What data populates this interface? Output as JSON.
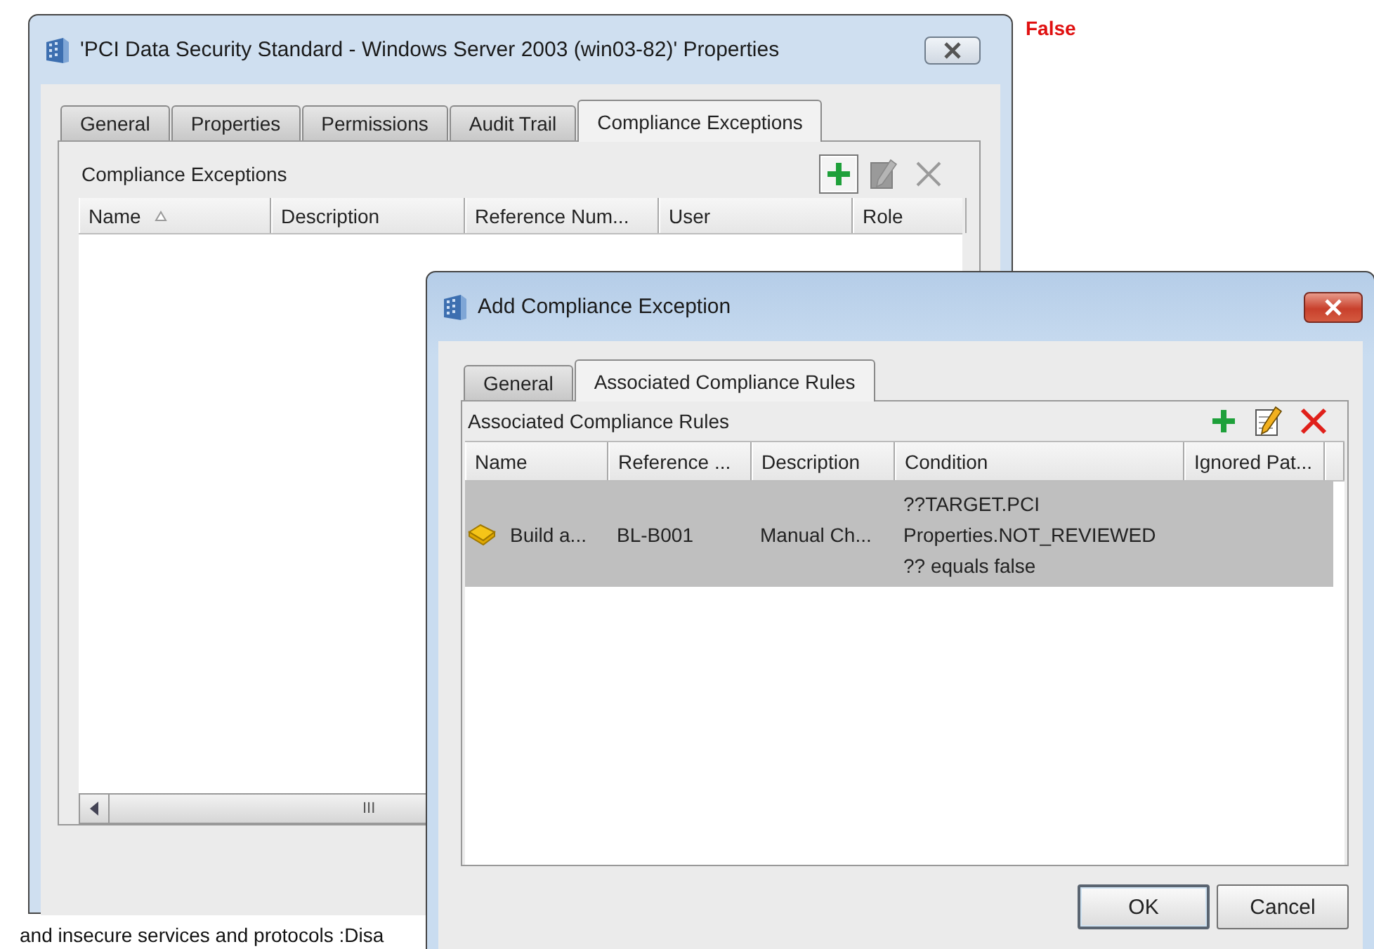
{
  "status_label": "False",
  "background_text": "and insecure services and protocols :Disa",
  "back_window": {
    "title": "'PCI Data Security Standard - Windows Server 2003 (win03-82)' Properties",
    "active": false,
    "tabs": [
      {
        "label": "General",
        "selected": false
      },
      {
        "label": "Properties",
        "selected": false
      },
      {
        "label": "Permissions",
        "selected": false
      },
      {
        "label": "Audit Trail",
        "selected": false
      },
      {
        "label": "Compliance Exceptions",
        "selected": true
      }
    ],
    "panel_title": "Compliance Exceptions",
    "toolbar": [
      {
        "kind": "add",
        "disabled": false,
        "focused": true
      },
      {
        "kind": "edit",
        "disabled": true,
        "focused": false
      },
      {
        "kind": "delete",
        "disabled": true,
        "focused": false
      }
    ],
    "columns": [
      {
        "label": "Name",
        "sorted": true
      },
      {
        "label": "Description",
        "sorted": false
      },
      {
        "label": "Reference Num...",
        "sorted": false
      },
      {
        "label": "User",
        "sorted": false
      },
      {
        "label": "Role",
        "sorted": false
      }
    ],
    "scrollbar_grip": "III"
  },
  "front_window": {
    "title": "Add Compliance Exception",
    "active": true,
    "tabs": [
      {
        "label": "General",
        "selected": false
      },
      {
        "label": "Associated Compliance Rules",
        "selected": true
      }
    ],
    "panel_title": "Associated Compliance Rules",
    "toolbar": [
      {
        "kind": "add",
        "disabled": false,
        "focused": false
      },
      {
        "kind": "edit",
        "disabled": false,
        "focused": false
      },
      {
        "kind": "delete",
        "disabled": false,
        "focused": false
      }
    ],
    "columns": [
      {
        "label": "Name"
      },
      {
        "label": "Reference ..."
      },
      {
        "label": "Description"
      },
      {
        "label": "Condition"
      },
      {
        "label": "Ignored Pat..."
      }
    ],
    "rows": [
      {
        "selected": true,
        "name": "Build a...",
        "reference": "BL-B001",
        "description": "Manual Ch...",
        "condition_lines": [
          "??TARGET.PCI",
          "Properties.NOT_REVIEWED",
          "?? equals false"
        ]
      }
    ],
    "buttons": [
      {
        "label": "OK",
        "default": true
      },
      {
        "label": "Cancel",
        "default": false
      }
    ]
  }
}
